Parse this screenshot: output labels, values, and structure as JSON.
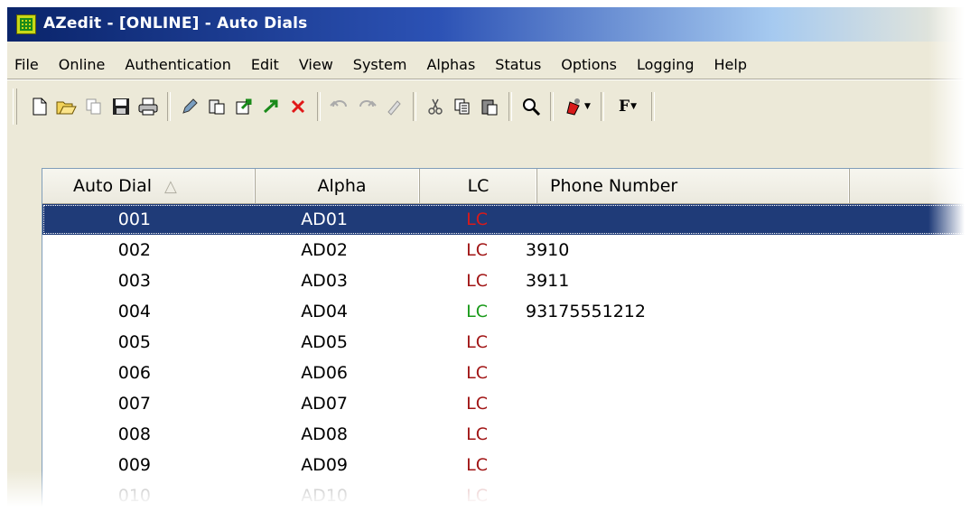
{
  "window": {
    "title": "AZedit - [ONLINE] - Auto Dials",
    "icon": "azedit-app-icon"
  },
  "menu": {
    "items": [
      {
        "label": "File"
      },
      {
        "label": "Online"
      },
      {
        "label": "Authentication"
      },
      {
        "label": "Edit"
      },
      {
        "label": "View"
      },
      {
        "label": "System"
      },
      {
        "label": "Alphas"
      },
      {
        "label": "Status"
      },
      {
        "label": "Options"
      },
      {
        "label": "Logging"
      },
      {
        "label": "Help"
      }
    ]
  },
  "toolbar": {
    "buttons": [
      "new-icon",
      "open-icon",
      "copy-disabled-icon",
      "save-icon",
      "print-icon",
      "pencil-icon",
      "paste-special-icon",
      "export-icon",
      "arrow-icon",
      "delete-icon",
      "undo-icon",
      "redo-icon",
      "eraser-icon",
      "cut-icon",
      "copy-icon",
      "paste-icon",
      "find-icon",
      "bell-dropdown-icon",
      "font-dropdown-icon"
    ],
    "font_label": "F"
  },
  "table": {
    "columns": [
      {
        "label": "Auto Dial",
        "sorted": "ascending"
      },
      {
        "label": "Alpha"
      },
      {
        "label": "LC"
      },
      {
        "label": "Phone Number"
      }
    ],
    "rows": [
      {
        "dial": "001",
        "alpha": "AD01",
        "lc": "LC",
        "lc_color": "red",
        "phone": "",
        "selected": true
      },
      {
        "dial": "002",
        "alpha": "AD02",
        "lc": "LC",
        "lc_color": "red",
        "phone": "3910"
      },
      {
        "dial": "003",
        "alpha": "AD03",
        "lc": "LC",
        "lc_color": "red",
        "phone": "3911"
      },
      {
        "dial": "004",
        "alpha": "AD04",
        "lc": "LC",
        "lc_color": "green",
        "phone": "93175551212"
      },
      {
        "dial": "005",
        "alpha": "AD05",
        "lc": "LC",
        "lc_color": "red",
        "phone": ""
      },
      {
        "dial": "006",
        "alpha": "AD06",
        "lc": "LC",
        "lc_color": "red",
        "phone": ""
      },
      {
        "dial": "007",
        "alpha": "AD07",
        "lc": "LC",
        "lc_color": "red",
        "phone": ""
      },
      {
        "dial": "008",
        "alpha": "AD08",
        "lc": "LC",
        "lc_color": "red",
        "phone": ""
      },
      {
        "dial": "009",
        "alpha": "AD09",
        "lc": "LC",
        "lc_color": "red",
        "phone": ""
      },
      {
        "dial": "010",
        "alpha": "AD10",
        "lc": "LC",
        "lc_color": "red",
        "phone": ""
      }
    ]
  },
  "colors": {
    "titlebar": "#0a246a",
    "selection": "#1f3b78",
    "lc_red": "#a11515",
    "lc_green": "#1a9a1a",
    "chrome": "#ece9d8"
  }
}
